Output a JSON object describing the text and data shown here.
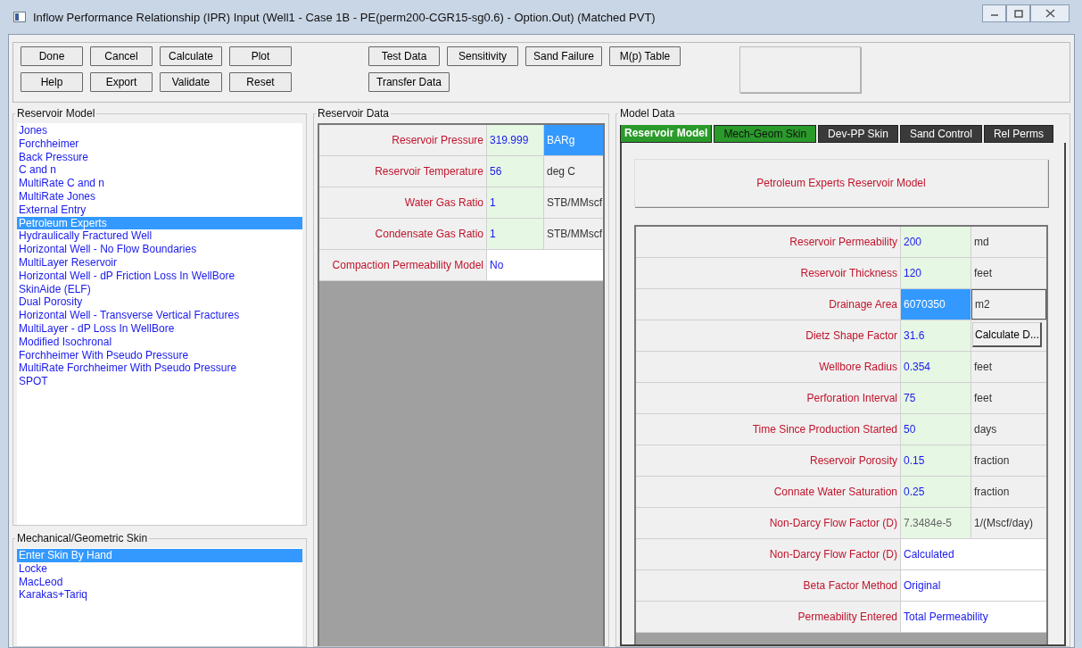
{
  "window": {
    "title": "Inflow Performance Relationship (IPR) Input (Well1 - Case 1B - PE(perm200-CGR15-sg0.6) - Option.Out) (Matched PVT)"
  },
  "toolbar": {
    "left_buttons": [
      [
        "Done",
        "Cancel",
        "Calculate",
        "Plot"
      ],
      [
        "Help",
        "Export",
        "Validate",
        "Reset"
      ]
    ],
    "middle_buttons": [
      [
        "Test Data",
        "Sensitivity",
        "Sand Failure",
        "M(p) Table"
      ],
      [
        "Transfer Data"
      ]
    ]
  },
  "reservoir_model": {
    "title": "Reservoir Model",
    "items": [
      {
        "label": "Jones",
        "selected": false
      },
      {
        "label": "Forchheimer",
        "selected": false
      },
      {
        "label": "Back Pressure",
        "selected": false
      },
      {
        "label": "C and n",
        "selected": false
      },
      {
        "label": "MultiRate C and n",
        "selected": false
      },
      {
        "label": "MultiRate Jones",
        "selected": false
      },
      {
        "label": "External Entry",
        "selected": false
      },
      {
        "label": "Petroleum Experts",
        "selected": true
      },
      {
        "label": "Hydraulically Fractured Well",
        "selected": false
      },
      {
        "label": "Horizontal Well - No Flow Boundaries",
        "selected": false
      },
      {
        "label": "MultiLayer Reservoir",
        "selected": false
      },
      {
        "label": "Horizontal Well - dP Friction Loss In WellBore",
        "selected": false
      },
      {
        "label": "SkinAide (ELF)",
        "selected": false
      },
      {
        "label": "Dual Porosity",
        "selected": false
      },
      {
        "label": "Horizontal Well - Transverse Vertical Fractures",
        "selected": false
      },
      {
        "label": "MultiLayer - dP Loss In WellBore",
        "selected": false
      },
      {
        "label": "Modified Isochronal",
        "selected": false
      },
      {
        "label": "Forchheimer With Pseudo Pressure",
        "selected": false
      },
      {
        "label": "MultiRate Forchheimer With Pseudo Pressure",
        "selected": false
      },
      {
        "label": "SPOT",
        "selected": false
      }
    ]
  },
  "mech_geom_skin": {
    "title": "Mechanical/Geometric Skin",
    "items": [
      {
        "label": "Enter Skin By Hand",
        "selected": true
      },
      {
        "label": "Locke",
        "selected": false
      },
      {
        "label": "MacLeod",
        "selected": false
      },
      {
        "label": "Karakas+Tariq",
        "selected": false
      }
    ]
  },
  "reservoir_data": {
    "title": "Reservoir Data",
    "rows": [
      {
        "label": "Reservoir Pressure",
        "kind": "input",
        "value": {
          "text": "319.999",
          "selected": false,
          "disabled": false
        },
        "unit": {
          "text": "BARg",
          "kind": "unit",
          "selected": true
        }
      },
      {
        "label": "Reservoir Temperature",
        "kind": "input",
        "value": {
          "text": "56",
          "selected": false,
          "disabled": false
        },
        "unit": {
          "text": "deg C",
          "kind": "unit",
          "selected": false
        }
      },
      {
        "label": "Water Gas Ratio",
        "kind": "input",
        "value": {
          "text": "1",
          "selected": false,
          "disabled": false
        },
        "unit": {
          "text": "STB/MMscf",
          "kind": "unit",
          "selected": false
        }
      },
      {
        "label": "Condensate Gas Ratio",
        "kind": "input",
        "value": {
          "text": "1",
          "selected": false,
          "disabled": false
        },
        "unit": {
          "text": "STB/MMscf",
          "kind": "unit",
          "selected": false
        }
      },
      {
        "label": "Compaction Permeability Model",
        "kind": "choice",
        "value": {
          "text": "No",
          "selected": false,
          "disabled": false
        }
      }
    ]
  },
  "model_data": {
    "title": "Model Data",
    "tabs": [
      {
        "label": "Reservoir Model",
        "selected": true,
        "color": "#2a9a2a"
      },
      {
        "label": "Mech-Geom Skin",
        "selected": false,
        "color": "#2a9a2a"
      },
      {
        "label": "Dev-PP Skin",
        "selected": false,
        "color": "#3a3a3a"
      },
      {
        "label": "Sand Control",
        "selected": false,
        "color": "#3a3a3a"
      },
      {
        "label": "Rel Perms",
        "selected": false,
        "color": "#3a3a3a"
      }
    ],
    "heading": "Petroleum Experts Reservoir Model",
    "rows": [
      {
        "label": "Reservoir Permeability",
        "kind": "input",
        "value": {
          "text": "200",
          "selected": false,
          "disabled": false
        },
        "unit": {
          "text": "md",
          "kind": "unit",
          "selected": false
        }
      },
      {
        "label": "Reservoir Thickness",
        "kind": "input",
        "value": {
          "text": "120",
          "selected": false,
          "disabled": false
        },
        "unit": {
          "text": "feet",
          "kind": "unit",
          "selected": false
        }
      },
      {
        "label": "Drainage Area",
        "kind": "input",
        "value": {
          "text": "6070350",
          "selected": true,
          "disabled": false
        },
        "unit": {
          "text": "m2",
          "kind": "unit",
          "selected": true
        }
      },
      {
        "label": "Dietz Shape Factor",
        "kind": "input",
        "value": {
          "text": "31.6",
          "selected": false,
          "disabled": false
        },
        "unit": {
          "text": "Calculate D...",
          "kind": "button",
          "selected": false
        }
      },
      {
        "label": "Wellbore Radius",
        "kind": "input",
        "value": {
          "text": "0.354",
          "selected": false,
          "disabled": false
        },
        "unit": {
          "text": "feet",
          "kind": "unit",
          "selected": false
        }
      },
      {
        "label": "Perforation Interval",
        "kind": "input",
        "value": {
          "text": "75",
          "selected": false,
          "disabled": false
        },
        "unit": {
          "text": "feet",
          "kind": "unit",
          "selected": false
        }
      },
      {
        "label": "Time Since Production Started",
        "kind": "input",
        "value": {
          "text": "50",
          "selected": false,
          "disabled": false
        },
        "unit": {
          "text": "days",
          "kind": "unit",
          "selected": false
        }
      },
      {
        "label": "Reservoir Porosity",
        "kind": "input",
        "value": {
          "text": "0.15",
          "selected": false,
          "disabled": false
        },
        "unit": {
          "text": "fraction",
          "kind": "unit",
          "selected": false
        }
      },
      {
        "label": "Connate Water Saturation",
        "kind": "input",
        "value": {
          "text": "0.25",
          "selected": false,
          "disabled": false
        },
        "unit": {
          "text": "fraction",
          "kind": "unit",
          "selected": false
        }
      },
      {
        "label": "Non-Darcy Flow Factor (D)",
        "kind": "input",
        "value": {
          "text": "7.3484e-5",
          "selected": false,
          "disabled": true
        },
        "unit": {
          "text": "1/(Mscf/day)",
          "kind": "unit",
          "selected": false
        }
      },
      {
        "label": "Non-Darcy Flow Factor (D)",
        "kind": "choice",
        "value": {
          "text": "Calculated",
          "selected": false,
          "disabled": false
        }
      },
      {
        "label": "Beta Factor Method",
        "kind": "choice",
        "value": {
          "text": "Original",
          "selected": false,
          "disabled": false
        }
      },
      {
        "label": "Permeability Entered",
        "kind": "choice",
        "value": {
          "text": "Total Permeability",
          "selected": false,
          "disabled": false
        }
      }
    ]
  }
}
